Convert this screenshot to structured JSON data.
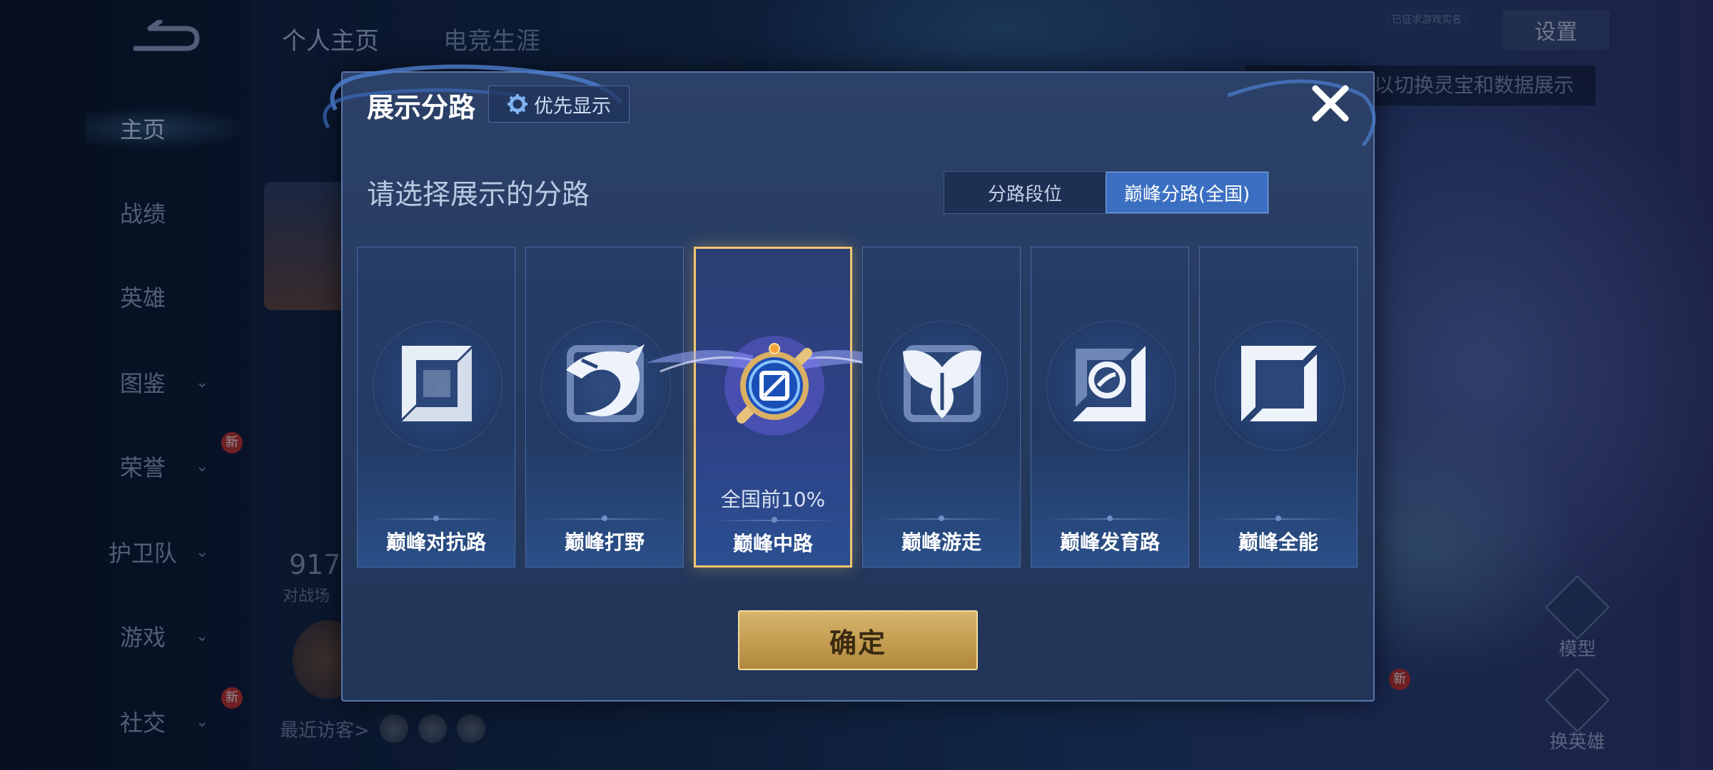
{
  "nav": {
    "items": [
      {
        "label": "主页",
        "active": true,
        "chevron": false
      },
      {
        "label": "战绩",
        "active": false,
        "chevron": false
      },
      {
        "label": "英雄",
        "active": false,
        "chevron": false
      },
      {
        "label": "图鉴",
        "active": false,
        "chevron": true
      },
      {
        "label": "荣誉",
        "active": false,
        "chevron": true,
        "badge": "新"
      },
      {
        "label": "护卫队",
        "active": false,
        "chevron": true
      },
      {
        "label": "游戏",
        "active": false,
        "chevron": true
      },
      {
        "label": "社交",
        "active": false,
        "chevron": true,
        "badge": "新"
      }
    ]
  },
  "top_tabs": [
    "个人主页",
    "电竞生涯"
  ],
  "settings_label": "设置",
  "top_tip": "已征求游戏实名",
  "hint_text": "以切换灵宝和数据展示",
  "stats": {
    "value": "917",
    "label": "对战场"
  },
  "visitors_label": "最近访客>",
  "right_buttons": [
    "模型",
    "换英雄"
  ],
  "right_badge": "新",
  "modal": {
    "title": "展示分路",
    "priority_label": "优先显示",
    "subtitle": "请选择展示的分路",
    "segments": [
      {
        "label": "分路段位",
        "active": false
      },
      {
        "label": "巅峰分路(全国)",
        "active": true
      }
    ],
    "cards": [
      {
        "name": "巅峰对抗路",
        "icon": "sword-lane-icon",
        "selected": false,
        "rank": ""
      },
      {
        "name": "巅峰打野",
        "icon": "dragon-jungle-icon",
        "selected": false,
        "rank": ""
      },
      {
        "name": "巅峰中路",
        "icon": "mid-lane-emblem-icon",
        "selected": true,
        "rank": "全国前10%"
      },
      {
        "name": "巅峰游走",
        "icon": "wings-roam-icon",
        "selected": false,
        "rank": ""
      },
      {
        "name": "巅峰发育路",
        "icon": "bow-marksman-icon",
        "selected": false,
        "rank": ""
      },
      {
        "name": "巅峰全能",
        "icon": "all-round-icon",
        "selected": false,
        "rank": ""
      }
    ],
    "confirm_label": "确定"
  },
  "colors": {
    "accent_blue": "#3b6fc1",
    "selected_border": "#f2c66e",
    "confirm_gold": "#c39c50"
  }
}
